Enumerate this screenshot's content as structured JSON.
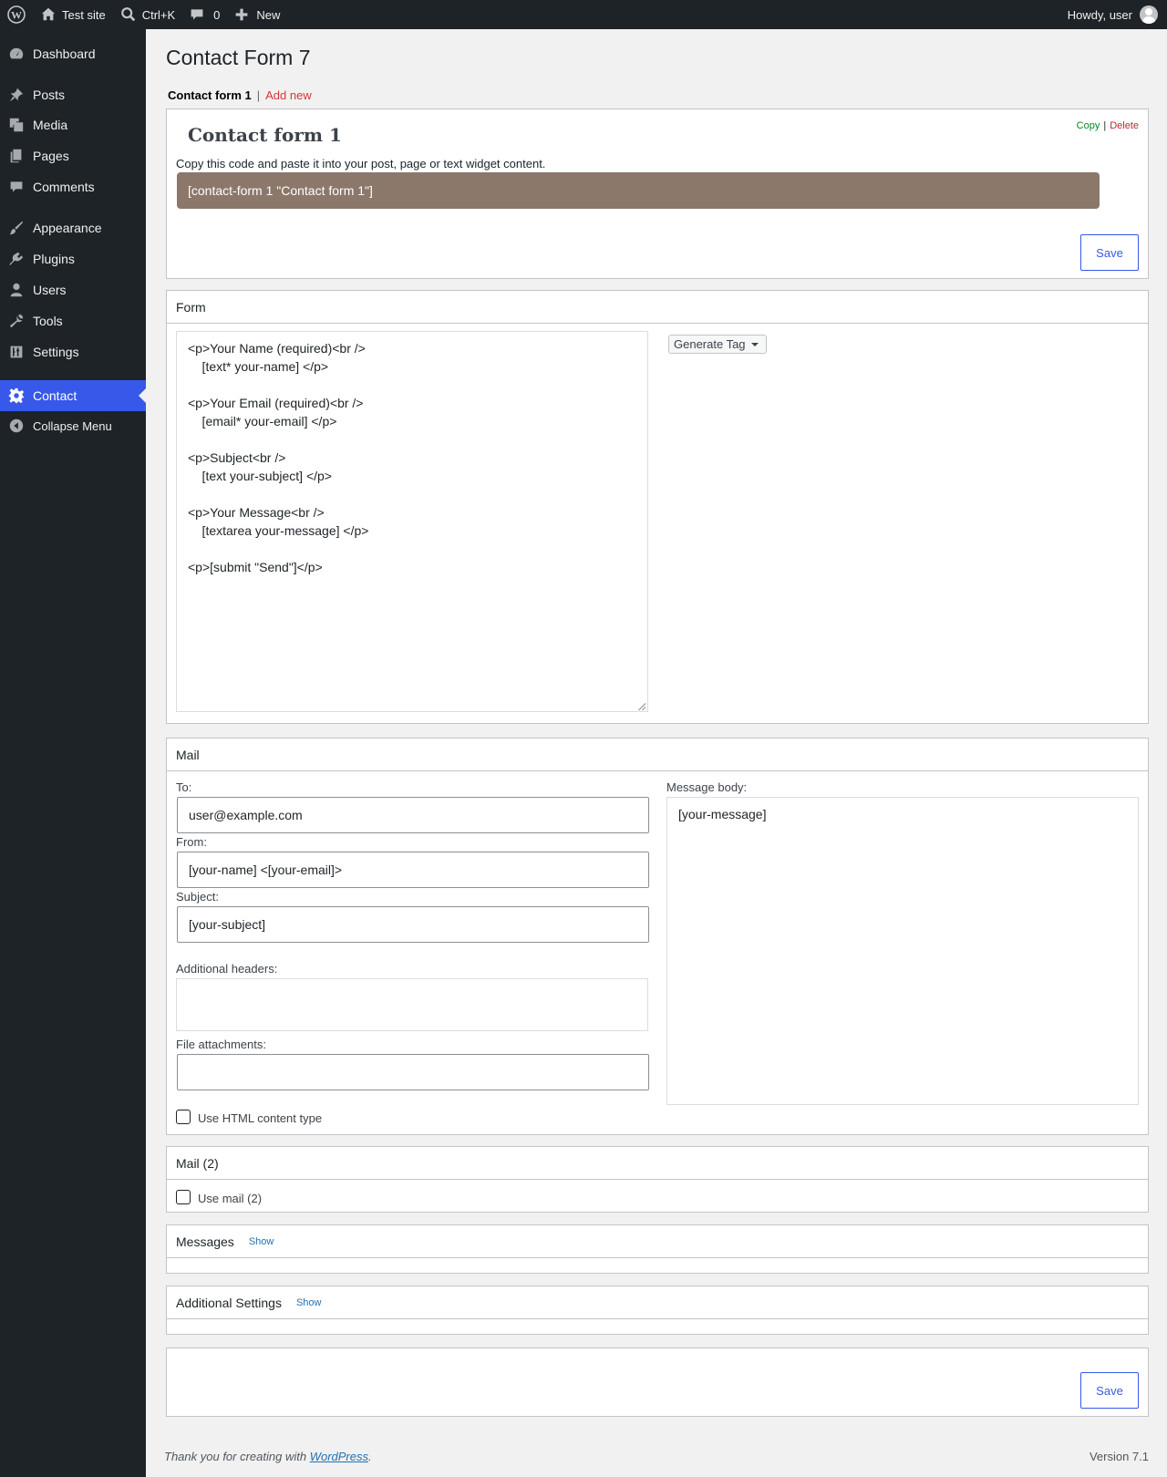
{
  "adminbar": {
    "site_name": "Test site",
    "search_shortcut": "Ctrl+K",
    "comments_count": "0",
    "new_label": "New",
    "howdy": "Howdy, user"
  },
  "sidebar": {
    "items": [
      {
        "label": "Dashboard",
        "icon": "dashboard-icon"
      },
      {
        "label": "Posts",
        "icon": "pin-icon"
      },
      {
        "label": "Media",
        "icon": "media-icon"
      },
      {
        "label": "Pages",
        "icon": "pages-icon"
      },
      {
        "label": "Comments",
        "icon": "comment-icon"
      },
      {
        "label": "Appearance",
        "icon": "brush-icon"
      },
      {
        "label": "Plugins",
        "icon": "plug-icon"
      },
      {
        "label": "Users",
        "icon": "user-icon"
      },
      {
        "label": "Tools",
        "icon": "wrench-icon"
      },
      {
        "label": "Settings",
        "icon": "sliders-icon"
      },
      {
        "label": "Contact",
        "icon": "gear-icon"
      },
      {
        "label": "Collapse Menu",
        "icon": "collapse-icon"
      }
    ],
    "accent": "#3858e9"
  },
  "page": {
    "title": "Contact Form 7",
    "tabs": {
      "current": "Contact form 1",
      "separator": "|",
      "add_new": "Add new"
    }
  },
  "title_box": {
    "form_title": "Contact form 1",
    "copy": "Copy",
    "separator": "|",
    "delete": "Delete",
    "shortcode_desc": "Copy this code and paste it into your post, page or text widget content.",
    "shortcode": "[contact-form 1 \"Contact form 1\"]",
    "save": "Save"
  },
  "form_panel": {
    "heading": "Form",
    "code": "<p>Your Name (required)<br />\n    [text* your-name] </p>\n\n<p>Your Email (required)<br />\n    [email* your-email] </p>\n\n<p>Subject<br />\n    [text your-subject] </p>\n\n<p>Your Message<br />\n    [textarea your-message] </p>\n\n<p>[submit \"Send\"]</p>",
    "generate_tag": "Generate Tag"
  },
  "mail_panel": {
    "heading": "Mail",
    "to_label": "To:",
    "to_value": "user@example.com",
    "from_label": "From:",
    "from_value": "[your-name] <[your-email]>",
    "subject_label": "Subject:",
    "subject_value": "[your-subject]",
    "headers_label": "Additional headers:",
    "headers_value": "",
    "attachments_label": "File attachments:",
    "attachments_value": "",
    "html_label": "Use HTML content type",
    "body_label": "Message body:",
    "body_value": "[your-message]"
  },
  "mail2_panel": {
    "heading": "Mail (2)",
    "use_label": "Use mail (2)"
  },
  "messages_panel": {
    "heading": "Messages",
    "show": "Show"
  },
  "additional_panel": {
    "heading": "Additional Settings",
    "show": "Show"
  },
  "bottom_save": "Save",
  "footer": {
    "thanks_prefix": "Thank you for creating with ",
    "wp_link": "WordPress",
    "period": ".",
    "version": "Version 7.1"
  }
}
